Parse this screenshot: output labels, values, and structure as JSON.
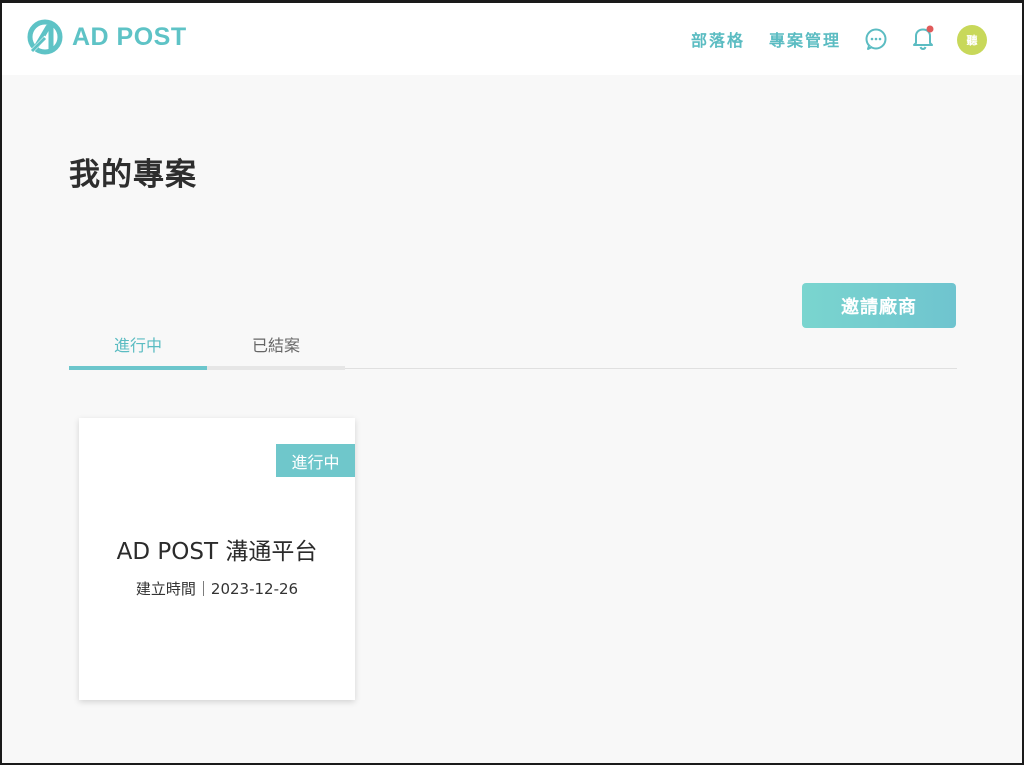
{
  "header": {
    "logo_text": "AD POST",
    "nav": {
      "blog_label": "部落格",
      "project_mgmt_label": "專案管理"
    },
    "avatar_text": "聽",
    "brand_color": "#5ec3c6",
    "notification_dot_color": "#e05a5a"
  },
  "page": {
    "title": "我的專案",
    "invite_button": "邀請廠商",
    "tabs": [
      {
        "label": "進行中",
        "active": true
      },
      {
        "label": "已結案",
        "active": false
      }
    ]
  },
  "projects": [
    {
      "status_badge": "進行中",
      "title": "AD POST 溝通平台",
      "created": "建立時間｜2023-12-26"
    }
  ]
}
